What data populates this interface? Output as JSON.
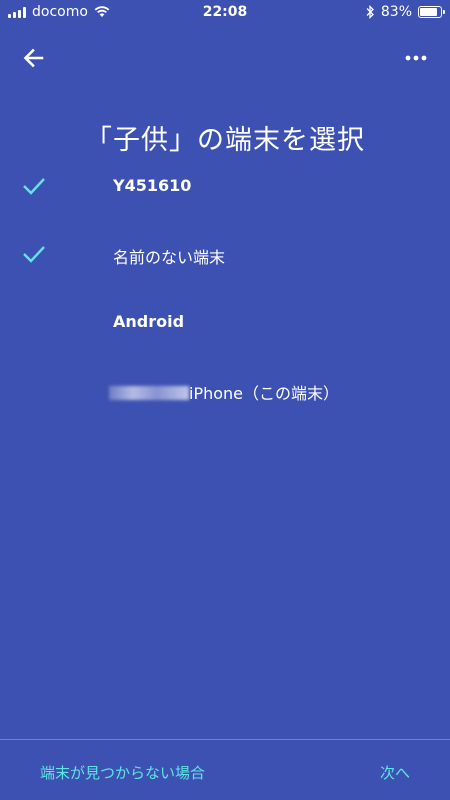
{
  "status_bar": {
    "carrier": "docomo",
    "time": "22:08",
    "battery_percent": "83%",
    "battery_level": 0.83
  },
  "header": {
    "title": "「子供」の端末を選択"
  },
  "devices": [
    {
      "name": "Y451610",
      "selected": true
    },
    {
      "name": "名前のない端末",
      "selected": true
    },
    {
      "name": "Android",
      "selected": false
    },
    {
      "name": "iPhone（この端末）",
      "selected": false
    }
  ],
  "footer": {
    "not_found_label": "端末が見つからない場合",
    "next_label": "次へ"
  },
  "colors": {
    "background": "#3d51b2",
    "accent": "#5ee6e4"
  },
  "icons": [
    "signal-icon",
    "wifi-icon",
    "bluetooth-icon",
    "battery-icon",
    "back-arrow-icon",
    "more-icon",
    "check-icon"
  ]
}
